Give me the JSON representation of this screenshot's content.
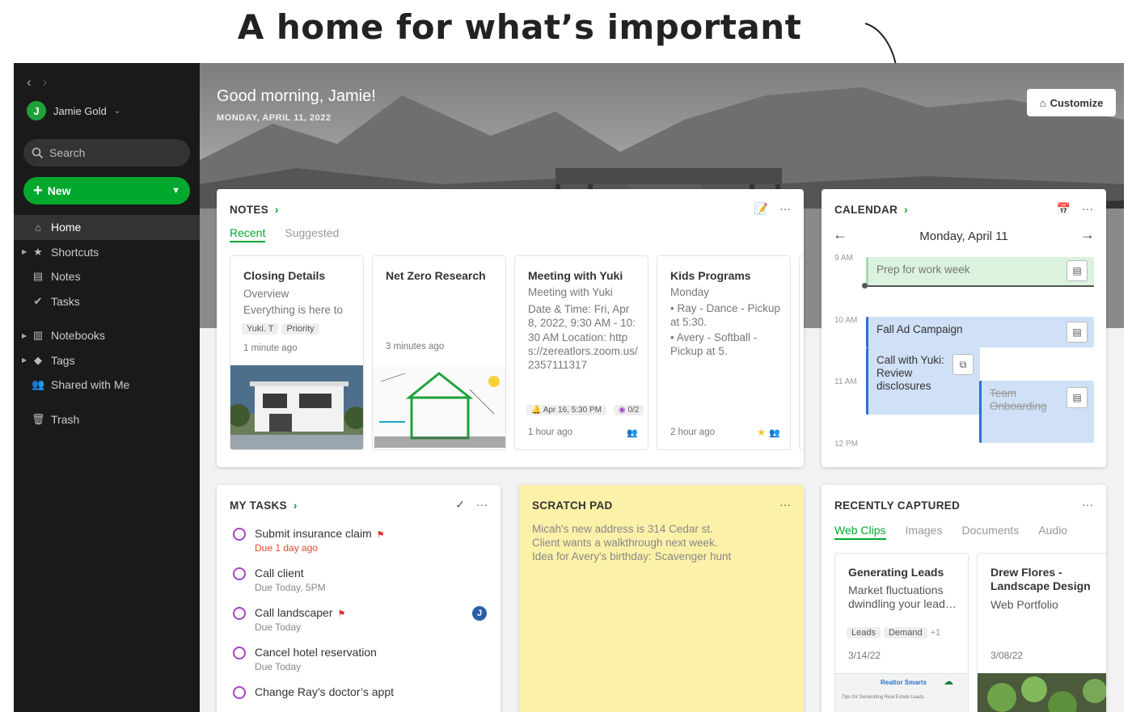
{
  "headline": "A home for what’s important",
  "sidebar": {
    "user": {
      "initial": "J",
      "name": "Jamie Gold"
    },
    "search_label": "Search",
    "new_label": "New",
    "items": [
      {
        "label": "Home",
        "icon": "home-icon"
      },
      {
        "label": "Shortcuts",
        "icon": "star-icon"
      },
      {
        "label": "Notes",
        "icon": "note-icon"
      },
      {
        "label": "Tasks",
        "icon": "check-circle-icon"
      },
      {
        "label": "Notebooks",
        "icon": "notebook-icon"
      },
      {
        "label": "Tags",
        "icon": "tag-icon"
      },
      {
        "label": "Shared with Me",
        "icon": "people-icon"
      },
      {
        "label": "Trash",
        "icon": "trash-icon"
      }
    ]
  },
  "hero": {
    "greeting": "Good morning, Jamie!",
    "date": "MONDAY, APRIL 11, 2022",
    "customize_label": "Customize"
  },
  "notes": {
    "title": "NOTES",
    "tabs": [
      "Recent",
      "Suggested"
    ],
    "cards": [
      {
        "title": "Closing Details",
        "line1": "Overview",
        "line2": "Everything is here to",
        "tags": [
          "Yuki. T",
          "Priority"
        ],
        "time": "1 minute ago"
      },
      {
        "title": "Net Zero Research",
        "time": "3 minutes ago"
      },
      {
        "title": "Meeting with Yuki",
        "body": "Meeting with Yuki",
        "body2": "Date & Time:  Fri, Apr 8, 2022, 9:30 AM - 10:30 AM Location: https://zereatlors.zoom.us/2357111317",
        "reminder": "Apr 16, 5:30 PM",
        "tasks": "0/2",
        "time": "1 hour ago"
      },
      {
        "title": "Kids Programs",
        "body": "Monday",
        "bullet1": "• Ray - Dance - Pickup at 5:30.",
        "bullet2": "• Avery - Softball - Pickup at 5.",
        "time": "2 hour ago"
      }
    ]
  },
  "calendar": {
    "title": "CALENDAR",
    "date": "Monday, April 11",
    "times": [
      "9 AM",
      "10 AM",
      "11 AM",
      "12 PM"
    ],
    "events": [
      "Prep for work week",
      "Fall Ad Campaign",
      "Call with Yuki: Review disclosures",
      "Team Onboarding"
    ]
  },
  "tasks": {
    "title": "MY TASKS",
    "items": [
      {
        "name": "Submit insurance claim",
        "due": "Due 1 day ago"
      },
      {
        "name": "Call client",
        "due": "Due Today, 5PM"
      },
      {
        "name": "Call landscaper",
        "due": "Due Today",
        "assignee": "J"
      },
      {
        "name": "Cancel hotel reservation",
        "due": "Due Today"
      },
      {
        "name": "Change Ray’s doctor’s appt",
        "due": ""
      }
    ]
  },
  "scratch": {
    "title": "SCRATCH PAD",
    "lines": [
      "Micah's new address is 314 Cedar st.",
      "Client wants a walkthrough next week.",
      "Idea for Avery's birthday: Scavenger hunt"
    ]
  },
  "captured": {
    "title": "RECENTLY CAPTURED",
    "tabs": [
      "Web Clips",
      "Images",
      "Documents",
      "Audio"
    ],
    "clips": [
      {
        "title": "Generating Leads",
        "body": "Market fluctuations dwindling your lead…",
        "tags": [
          "Leads",
          "Demand"
        ],
        "more": "+1",
        "date": "3/14/22",
        "thumb_title": "Realtor Smarts",
        "thumb_sub": "Tips for Generating Real Estate Leads"
      },
      {
        "title": "Drew Flores - Landscape Design",
        "body": "Web Portfolio",
        "date": "3/08/22"
      }
    ]
  },
  "colors": {
    "brand": "#00a82d",
    "sidebar": "#1a1a1a",
    "scratch": "#fbf1a8",
    "event": "#cfe0f7",
    "task_ring": "#a642c9"
  }
}
